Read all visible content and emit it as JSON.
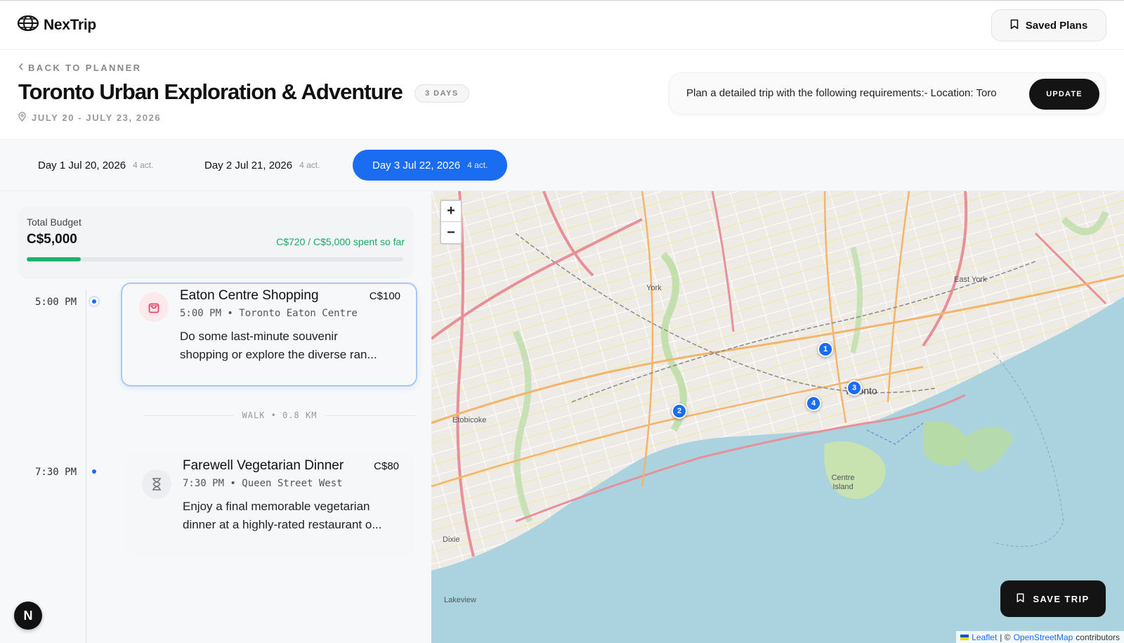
{
  "app": {
    "brand": "NexTrip",
    "saved_plans_label": "Saved Plans"
  },
  "trip": {
    "back_label": "BACK TO PLANNER",
    "title": "Toronto Urban Exploration & Adventure",
    "days_badge": "3 DAYS",
    "dates": "JULY 20 - JULY 23, 2026"
  },
  "prompt": {
    "text": "Plan a detailed trip with the following requirements:- Location: Toro",
    "update_label": "UPDATE"
  },
  "days": [
    {
      "label": "Day 1 Jul 20, 2026",
      "count": "4 act.",
      "active": false
    },
    {
      "label": "Day 2 Jul 21, 2026",
      "count": "4 act.",
      "active": false
    },
    {
      "label": "Day 3 Jul 22, 2026",
      "count": "4 act.",
      "active": true
    }
  ],
  "budget": {
    "label": "Total Budget",
    "total": "C$5,000",
    "spent_text": "C$720 / C$5,000 spent so far",
    "spent_fraction": 0.144
  },
  "activities": [
    {
      "time": "5:00 PM",
      "title": "Eaton Centre Shopping",
      "price": "C$100",
      "meta": "5:00 PM • Toronto Eaton Centre",
      "desc_line1": "Do some last-minute souvenir",
      "desc_line2": "shopping or explore the diverse ran...",
      "icon": "shopping-bag-icon"
    },
    {
      "time": "7:30 PM",
      "title": "Farewell Vegetarian Dinner",
      "price": "C$80",
      "meta": "7:30 PM • Queen Street West",
      "desc_line1": "Enjoy a final memorable vegetarian",
      "desc_line2": "dinner at a highly-rated restaurant o...",
      "icon": "hourglass-icon"
    }
  ],
  "walk_separator": "WALK • 0.8 KM",
  "map": {
    "zoom_in": "+",
    "zoom_out": "−",
    "markers": [
      "1",
      "2",
      "3",
      "4"
    ],
    "labels": {
      "york": "York",
      "east_york": "East York",
      "toronto": "Toronto",
      "etobicoke": "Etobicoke",
      "centre_island": "Centre Island",
      "dixie": "Dixie",
      "lakeview": "Lakeview"
    },
    "save_trip_label": "SAVE TRIP",
    "attribution": {
      "leaflet": "Leaflet",
      "sep": "| ©",
      "osm": "OpenStreetMap",
      "contrib": "contributors"
    }
  },
  "floating_badge": "N",
  "colors": {
    "accent": "#1a6cf0",
    "budget_green": "#1aa861",
    "water": "#aad3df"
  }
}
